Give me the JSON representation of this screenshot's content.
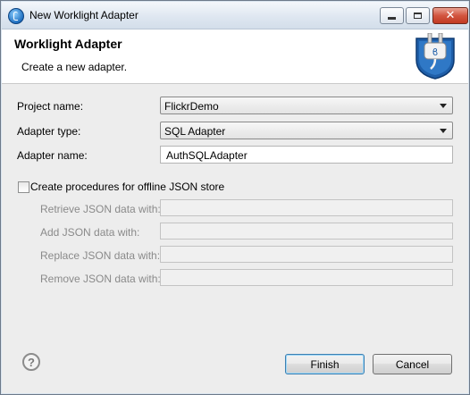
{
  "window": {
    "title": "New Worklight Adapter",
    "controls": {
      "minimize": "minimize-icon",
      "maximize": "maximize-icon",
      "close": "close-icon"
    }
  },
  "banner": {
    "title": "Worklight Adapter",
    "description": "Create a new adapter.",
    "icon": "plug-icon"
  },
  "form": {
    "project_name": {
      "label": "Project name:",
      "value": "FlickrDemo"
    },
    "adapter_type": {
      "label": "Adapter type:",
      "value": "SQL Adapter"
    },
    "adapter_name": {
      "label": "Adapter name:",
      "value": "AuthSQLAdapter"
    }
  },
  "offline": {
    "checkbox_label": "Create procedures for offline JSON store",
    "checked": false,
    "fields": [
      {
        "label": "Retrieve JSON data with:",
        "value": ""
      },
      {
        "label": "Add JSON data with:",
        "value": ""
      },
      {
        "label": "Replace JSON data with:",
        "value": ""
      },
      {
        "label": "Remove JSON data with:",
        "value": ""
      }
    ]
  },
  "footer": {
    "help_glyph": "?",
    "finish_label": "Finish",
    "cancel_label": "Cancel"
  },
  "colors": {
    "dialog_bg": "#ededed",
    "default_button_border": "#3c7fb1",
    "close_button": "#c23a22",
    "banner_icon_blue": "#1e5ea8"
  }
}
